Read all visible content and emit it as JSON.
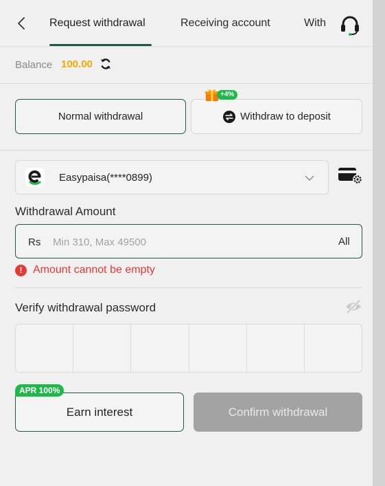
{
  "header": {
    "tabs": [
      {
        "label": "Request withdrawal",
        "active": true
      },
      {
        "label": "Receiving account",
        "active": false
      },
      {
        "label": "With",
        "active": false
      }
    ]
  },
  "balance": {
    "label": "Balance",
    "amount": "100.00"
  },
  "modes": {
    "normal_label": "Normal withdrawal",
    "deposit_label": "Withdraw to deposit",
    "deposit_badge": "+4%"
  },
  "account": {
    "selected": "Easypaisa(****0899)"
  },
  "amount": {
    "label": "Withdrawal Amount",
    "currency": "Rs",
    "value": "",
    "placeholder": "Min 310, Max 49500",
    "all_label": "All",
    "error": "Amount cannot be empty"
  },
  "password": {
    "label": "Verify withdrawal password",
    "digits": 6
  },
  "actions": {
    "earn_badge": "APR 100%",
    "earn_label": "Earn interest",
    "confirm_label": "Confirm withdrawal"
  },
  "colors": {
    "accent": "#1f5a45",
    "balance": "#f2a900",
    "error": "#e53935",
    "badge": "#1fb94a",
    "disabled": "#a3a3a3"
  }
}
